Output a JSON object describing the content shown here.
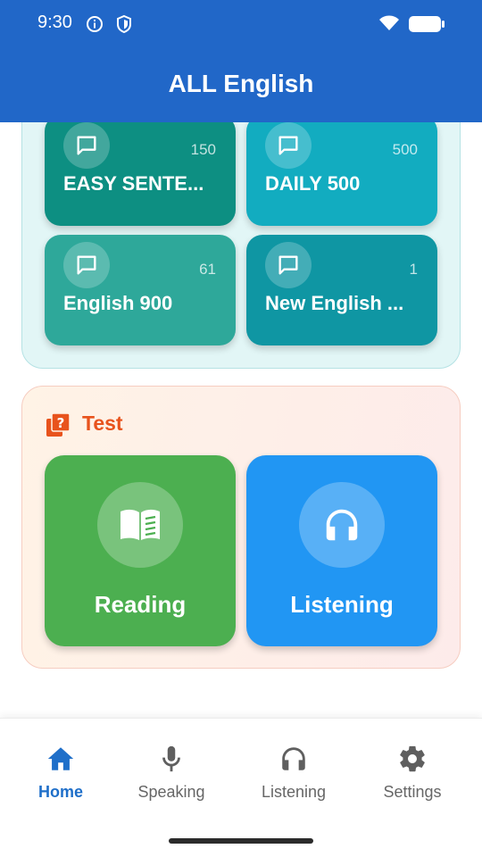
{
  "status_bar": {
    "time": "9:30"
  },
  "app_bar": {
    "title": "ALL English"
  },
  "courses": {
    "tiles": [
      {
        "label": "EASY SENTE...",
        "count": "150",
        "color": "#0d8f82"
      },
      {
        "label": "DAILY 500",
        "count": "500",
        "color": "#12acc0"
      },
      {
        "label": "English 900",
        "count": "61",
        "color": "#2ea89a"
      },
      {
        "label": "New English ...",
        "count": "1",
        "color": "#0f96a3"
      }
    ]
  },
  "test_section": {
    "title": "Test",
    "reading": {
      "label": "Reading",
      "color": "#4caf50"
    },
    "listening": {
      "label": "Listening",
      "color": "#2196f3"
    }
  },
  "bottom_nav": {
    "items": [
      {
        "label": "Home",
        "icon": "home-icon",
        "active": true
      },
      {
        "label": "Speaking",
        "icon": "microphone-icon",
        "active": false
      },
      {
        "label": "Listening",
        "icon": "headphones-icon",
        "active": false
      },
      {
        "label": "Settings",
        "icon": "gear-icon",
        "active": false
      }
    ]
  },
  "colors": {
    "app_bar": "#2167c8",
    "accent": "#1f6fc9",
    "test_title": "#e8531d"
  }
}
